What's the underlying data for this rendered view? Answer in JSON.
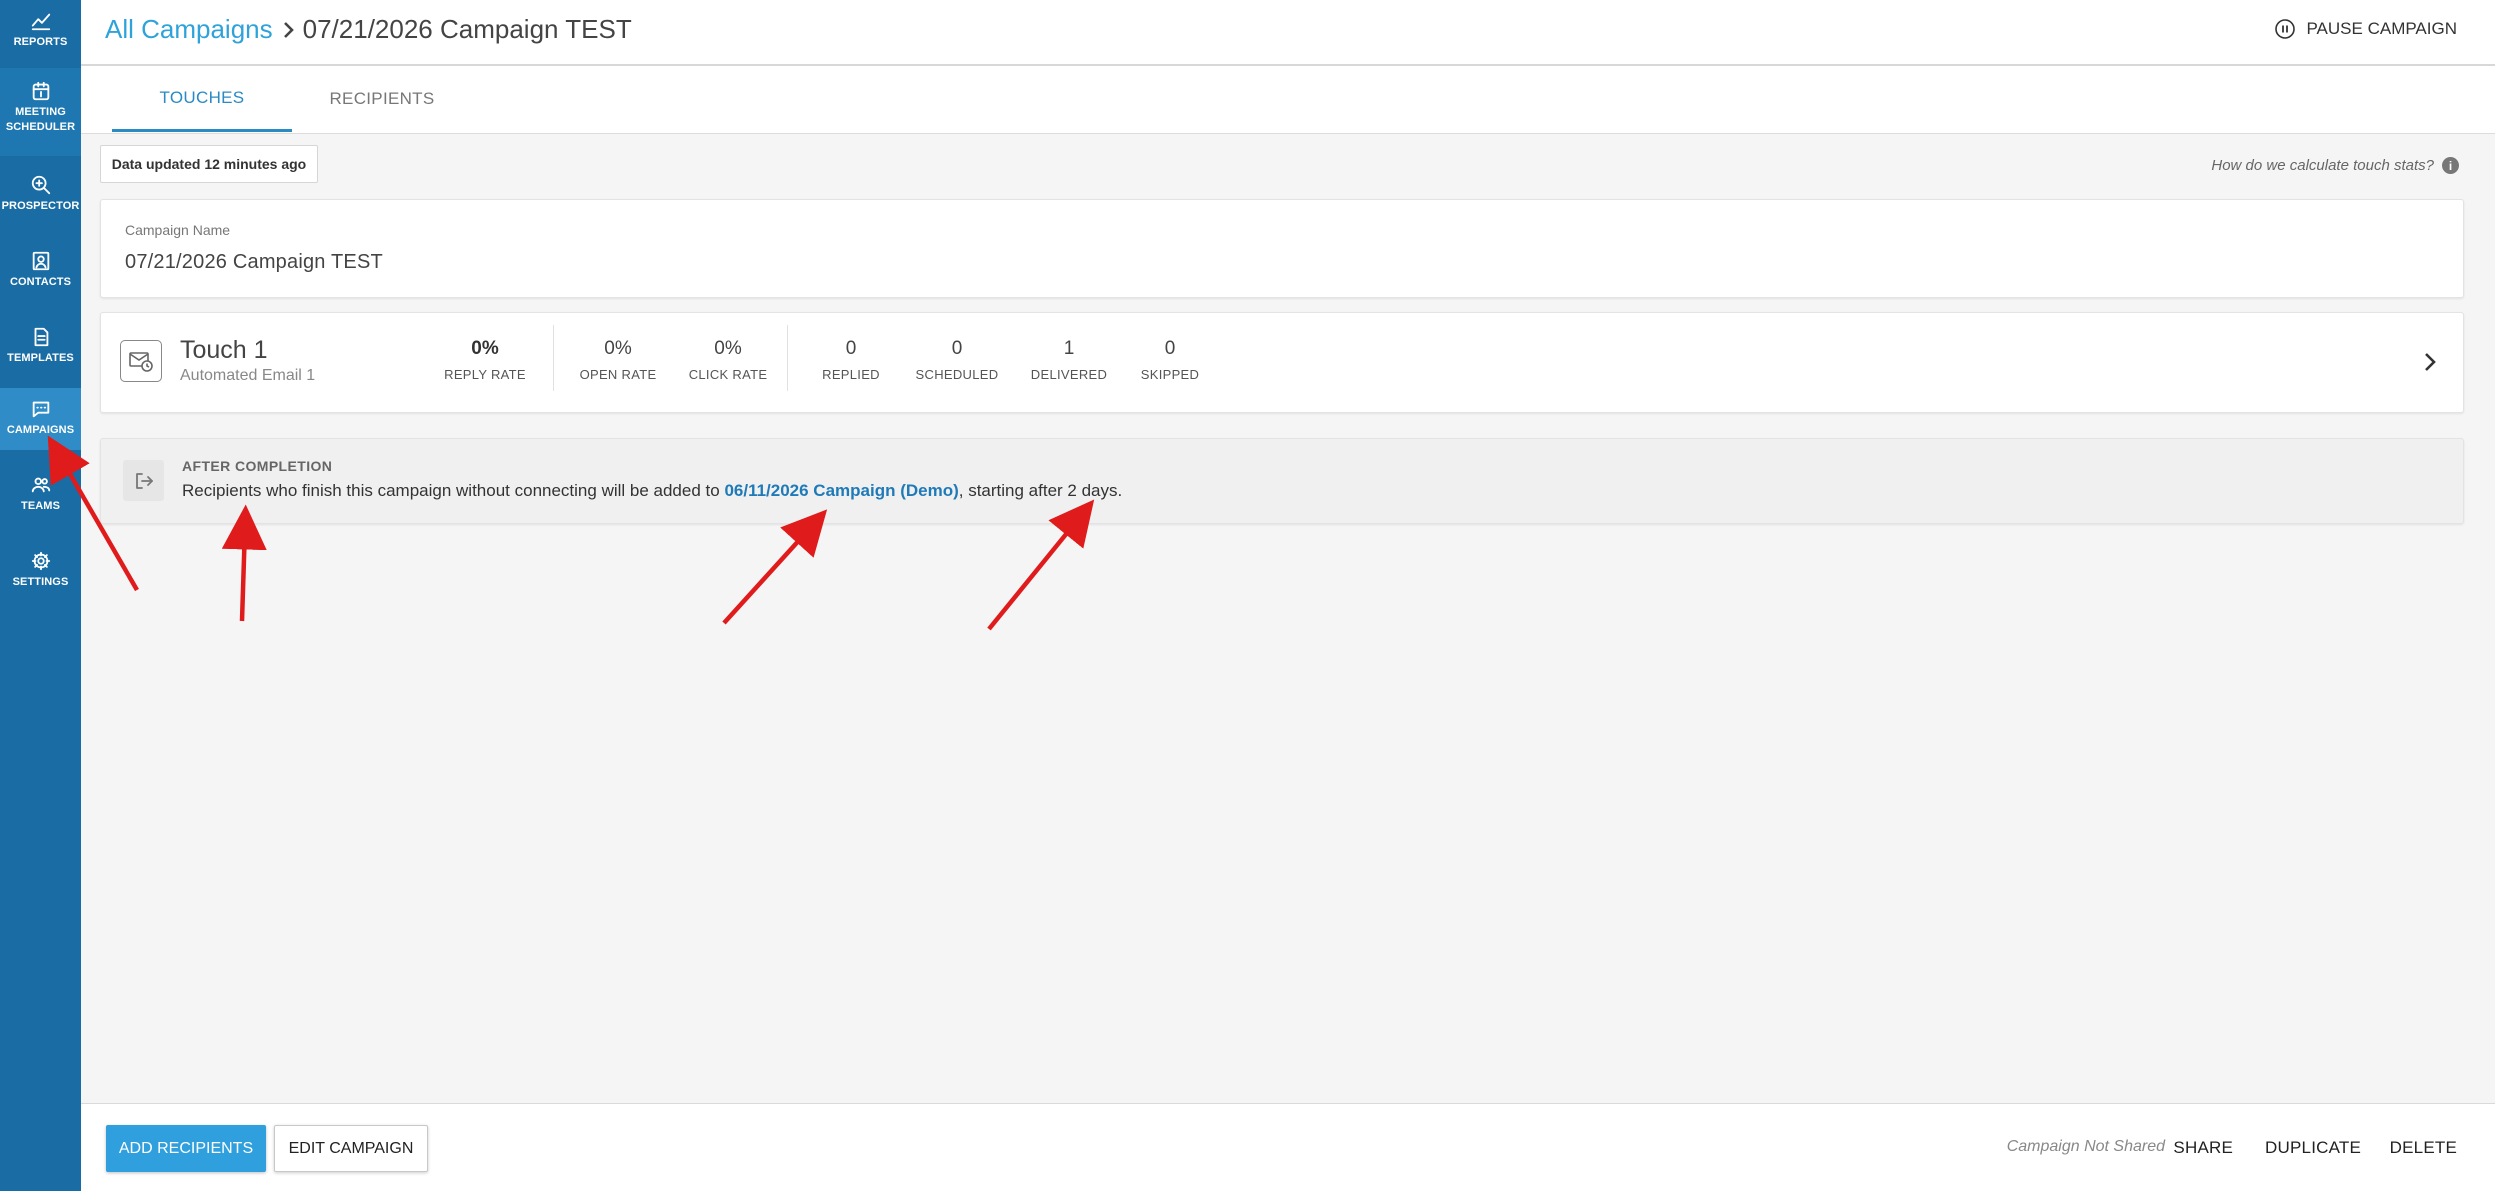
{
  "sidebar": {
    "items": [
      {
        "label": "REPORTS",
        "icon": "chart-line-icon"
      },
      {
        "label": "MEETING\nSCHEDULER",
        "icon": "calendar-icon"
      },
      {
        "label": "PROSPECTOR",
        "icon": "magnifier-plus-icon"
      },
      {
        "label": "CONTACTS",
        "icon": "contact-card-icon"
      },
      {
        "label": "TEMPLATES",
        "icon": "document-icon"
      },
      {
        "label": "CAMPAIGNS",
        "icon": "chat-bubble-icon",
        "active": true
      },
      {
        "label": "TEAMS",
        "icon": "people-icon"
      },
      {
        "label": "SETTINGS",
        "icon": "gear-icon"
      }
    ]
  },
  "header": {
    "breadcrumb_root": "All Campaigns",
    "breadcrumb_current": "07/21/2026 Campaign TEST",
    "pause_label": "PAUSE CAMPAIGN"
  },
  "tabs": [
    {
      "label": "TOUCHES",
      "active": true
    },
    {
      "label": "RECIPIENTS",
      "active": false
    }
  ],
  "data_updated": "Data updated 12 minutes ago",
  "stats_help": "How do we calculate touch stats?",
  "campaign": {
    "name_label": "Campaign Name",
    "name": "07/21/2026 Campaign TEST"
  },
  "touch": {
    "title": "Touch 1",
    "subtitle": "Automated Email 1",
    "rates": [
      {
        "value": "0%",
        "label": "REPLY RATE"
      },
      {
        "value": "0%",
        "label": "OPEN RATE"
      },
      {
        "value": "0%",
        "label": "CLICK RATE"
      }
    ],
    "counts": [
      {
        "value": "0",
        "label": "REPLIED"
      },
      {
        "value": "0",
        "label": "SCHEDULED"
      },
      {
        "value": "1",
        "label": "DELIVERED"
      },
      {
        "value": "0",
        "label": "SKIPPED"
      }
    ]
  },
  "after_completion": {
    "heading": "AFTER COMPLETION",
    "text_before": "Recipients who finish this campaign without connecting will be added to ",
    "link": "06/11/2026 Campaign (Demo)",
    "text_after": ", starting after 2 days."
  },
  "footer": {
    "add_recipients": "ADD RECIPIENTS",
    "edit_campaign": "EDIT CAMPAIGN",
    "share_status": "Campaign Not Shared",
    "share": "SHARE",
    "duplicate": "DUPLICATE",
    "delete": "DELETE"
  },
  "colors": {
    "sidebar": "#1a6da4",
    "sidebar_active": "#2f8cc6",
    "accent": "#2fa3d9",
    "link": "#1f7ab8",
    "annotation_arrow": "#e01b1b"
  }
}
